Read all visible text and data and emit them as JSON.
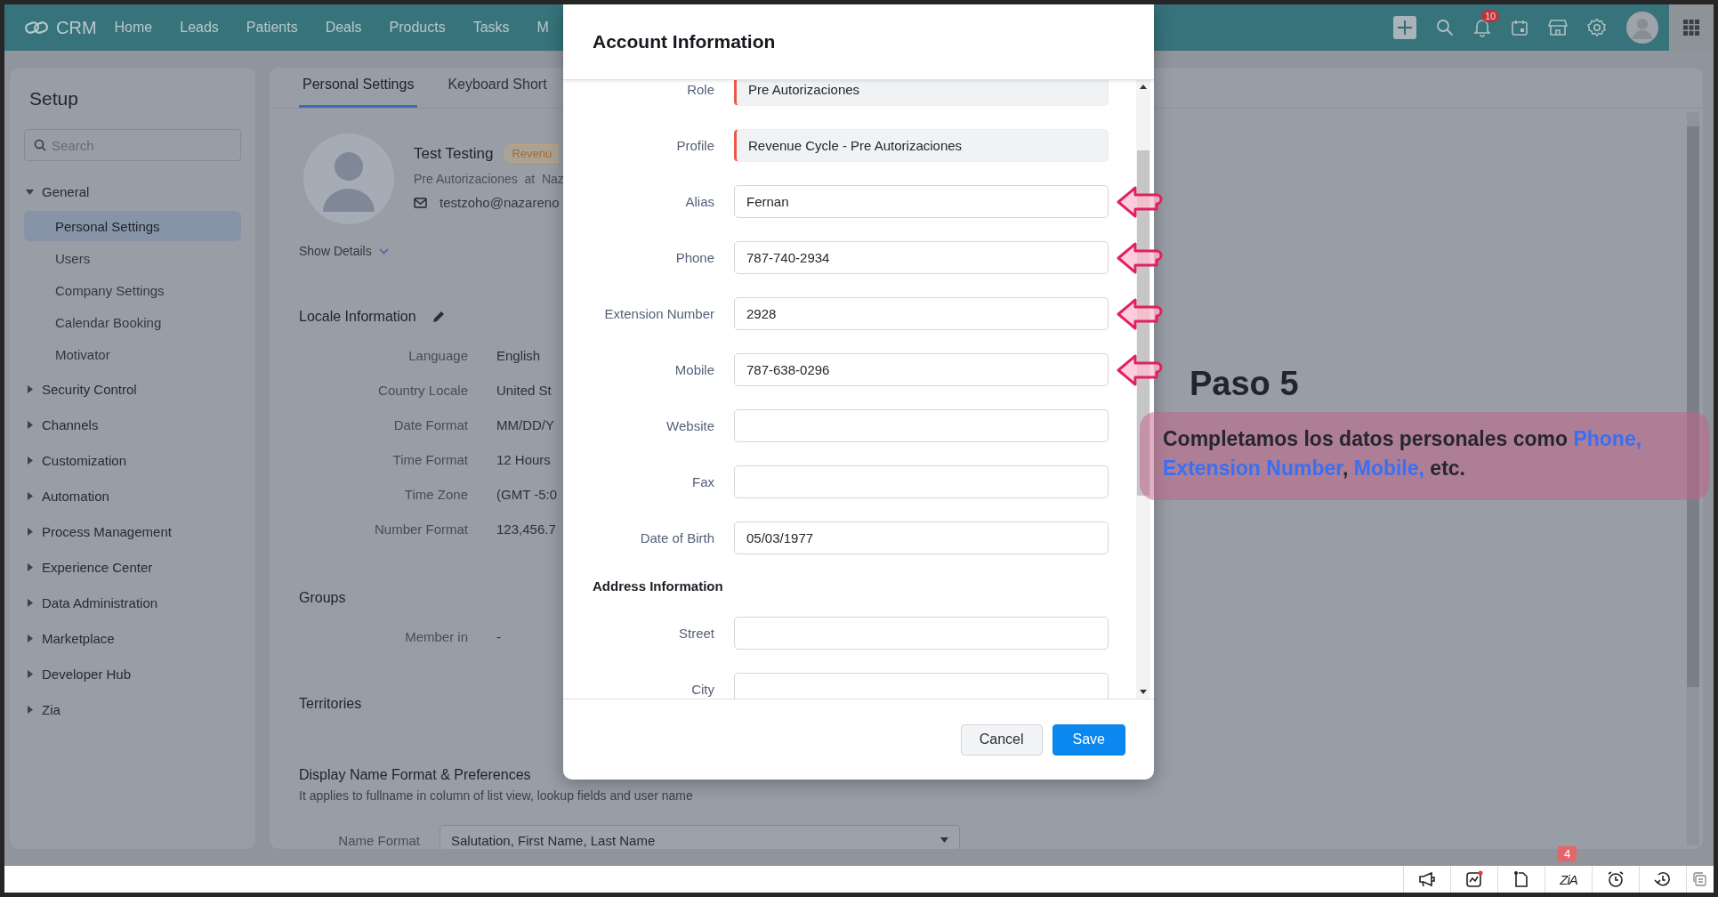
{
  "top_nav": {
    "logo": "CRM",
    "items": [
      "Home",
      "Leads",
      "Patients",
      "Deals",
      "Products",
      "Tasks",
      "M"
    ],
    "notification_count": "10"
  },
  "sidebar": {
    "title": "Setup",
    "search": {
      "placeholder": "Search"
    },
    "items": [
      {
        "label": "General",
        "expanded": true,
        "children": [
          {
            "label": "Personal Settings",
            "selected": true
          },
          {
            "label": "Users",
            "selected": false
          },
          {
            "label": "Company Settings",
            "selected": false
          },
          {
            "label": "Calendar Booking",
            "selected": false
          },
          {
            "label": "Motivator",
            "selected": false
          }
        ]
      },
      {
        "label": "Security Control",
        "expanded": false
      },
      {
        "label": "Channels",
        "expanded": false
      },
      {
        "label": "Customization",
        "expanded": false
      },
      {
        "label": "Automation",
        "expanded": false
      },
      {
        "label": "Process Management",
        "expanded": false
      },
      {
        "label": "Experience Center",
        "expanded": false
      },
      {
        "label": "Data Administration",
        "expanded": false
      },
      {
        "label": "Marketplace",
        "expanded": false
      },
      {
        "label": "Developer Hub",
        "expanded": false
      },
      {
        "label": "Zia",
        "expanded": false
      }
    ]
  },
  "tabs": [
    {
      "label": "Personal Settings",
      "selected": true
    },
    {
      "label": "Keyboard Short",
      "selected": false
    }
  ],
  "profile": {
    "name": "Test Testing",
    "badge": "Revenu",
    "role_line": "Pre Autorizaciones  at  Naz",
    "email": "testzoho@nazareno",
    "show_details": "Show Details"
  },
  "locale": {
    "title": "Locale Information",
    "rows": [
      {
        "label": "Language",
        "value": "English"
      },
      {
        "label": "Country Locale",
        "value": "United St"
      },
      {
        "label": "Date Format",
        "value": "MM/DD/Y"
      },
      {
        "label": "Time Format",
        "value": "12 Hours"
      },
      {
        "label": "Time Zone",
        "value": "(GMT -5:0"
      },
      {
        "label": "Number Format",
        "value": "123,456.7"
      }
    ]
  },
  "groups": {
    "title": "Groups",
    "rows": [
      {
        "label": "Member in",
        "value": "-"
      }
    ]
  },
  "territories": {
    "title": "Territories"
  },
  "display_name": {
    "title": "Display Name Format & Preferences",
    "description": "It applies to fullname in column of list view, lookup fields and user name",
    "field_label": "Name Format",
    "value": "Salutation, First Name, Last Name"
  },
  "modal": {
    "title": "Account Information",
    "rows": [
      {
        "kind": "field",
        "label": "Role",
        "value": "Pre Autorizaciones",
        "locked": true,
        "marked": false
      },
      {
        "kind": "field",
        "label": "Profile",
        "value": "Revenue Cycle - Pre Autorizaciones",
        "locked": true,
        "marked": false
      },
      {
        "kind": "field",
        "label": "Alias",
        "value": "Fernan",
        "locked": false,
        "marked": true
      },
      {
        "kind": "field",
        "label": "Phone",
        "value": "787-740-2934",
        "locked": false,
        "marked": true
      },
      {
        "kind": "field",
        "label": "Extension Number",
        "value": "2928",
        "locked": false,
        "marked": true
      },
      {
        "kind": "field",
        "label": "Mobile",
        "value": "787-638-0296",
        "locked": false,
        "marked": true
      },
      {
        "kind": "field",
        "label": "Website",
        "locked": false,
        "marked": false
      },
      {
        "kind": "field",
        "label": "Fax",
        "locked": false,
        "marked": false
      },
      {
        "kind": "field",
        "label": "Date of Birth",
        "value": "05/03/1977",
        "locked": false,
        "marked": false
      },
      {
        "kind": "heading",
        "label": "Address Information"
      },
      {
        "kind": "field",
        "label": "Street",
        "locked": false,
        "marked": false
      },
      {
        "kind": "field",
        "label": "City",
        "locked": false,
        "marked": false
      }
    ],
    "buttons": [
      {
        "label": "Cancel",
        "kind": "secondary"
      },
      {
        "label": "Save",
        "kind": "primary"
      }
    ]
  },
  "annotation": {
    "title": "Paso 5",
    "parts": [
      {
        "text": "Completamos los datos personales como ",
        "highlight": false
      },
      {
        "text": "Phone, Extension Number",
        "highlight": true
      },
      {
        "text": ", ",
        "highlight": false
      },
      {
        "text": "Mobile,",
        "highlight": true
      },
      {
        "text": " etc.",
        "highlight": false
      }
    ]
  },
  "bottom_bar": {
    "assistant_label": "ZiA",
    "badge": "4"
  }
}
